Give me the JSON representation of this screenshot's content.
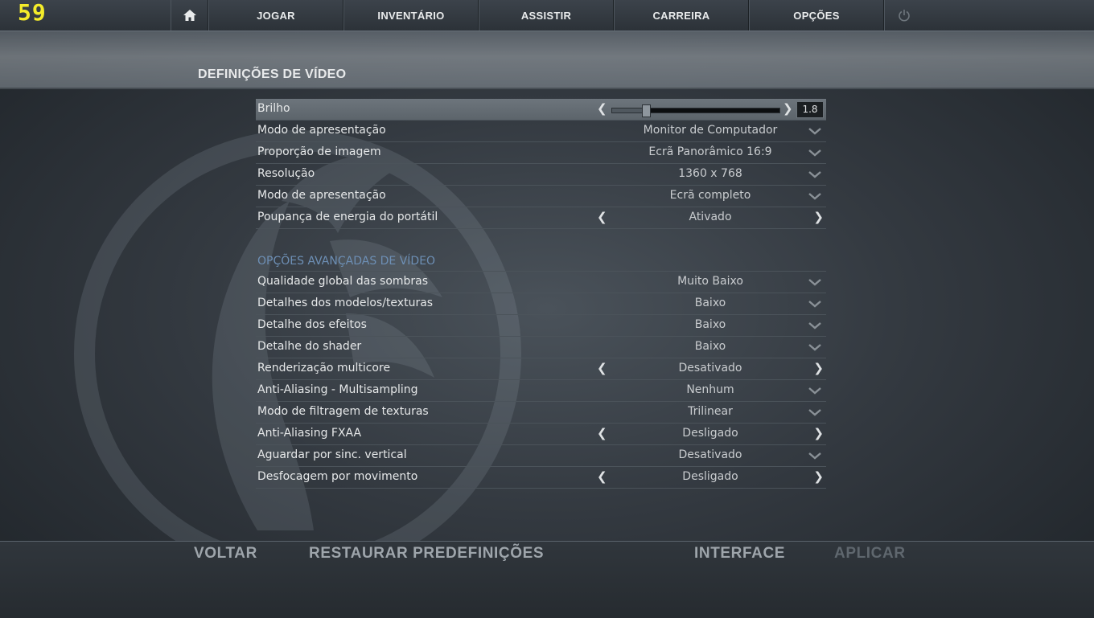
{
  "fps": "59",
  "nav": {
    "items": [
      "JOGAR",
      "INVENTÁRIO",
      "ASSISTIR",
      "CARREIRA",
      "OPÇÕES"
    ]
  },
  "page": {
    "title": "DEFINIÇÕES DE VÍDEO"
  },
  "brightness": {
    "label": "Brilho",
    "value": "1.8",
    "fraction": 0.2
  },
  "basic_settings": [
    {
      "label": "Modo de apresentação",
      "value": "Monitor de Computador",
      "control": "dropdown"
    },
    {
      "label": "Proporção de imagem",
      "value": "Ecrã Panorâmico 16:9",
      "control": "dropdown"
    },
    {
      "label": "Resolução",
      "value": "1360 x 768",
      "control": "dropdown"
    },
    {
      "label": "Modo de apresentação",
      "value": "Ecrã completo",
      "control": "dropdown"
    },
    {
      "label": "Poupança de energia do portátil",
      "value": "Ativado",
      "control": "toggle"
    }
  ],
  "advanced": {
    "title": "OPÇÕES AVANÇADAS DE VÍDEO",
    "settings": [
      {
        "label": "Qualidade global das sombras",
        "value": "Muito Baixo",
        "control": "dropdown"
      },
      {
        "label": "Detalhes dos modelos/texturas",
        "value": "Baixo",
        "control": "dropdown"
      },
      {
        "label": "Detalhe dos efeitos",
        "value": "Baixo",
        "control": "dropdown"
      },
      {
        "label": "Detalhe do shader",
        "value": "Baixo",
        "control": "dropdown"
      },
      {
        "label": "Renderização multicore",
        "value": "Desativado",
        "control": "toggle"
      },
      {
        "label": "Anti-Aliasing - Multisampling",
        "value": "Nenhum",
        "control": "dropdown"
      },
      {
        "label": "Modo de filtragem de texturas",
        "value": "Trilinear",
        "control": "dropdown"
      },
      {
        "label": "Anti-Aliasing FXAA",
        "value": "Desligado",
        "control": "toggle"
      },
      {
        "label": "Aguardar por sinc. vertical",
        "value": "Desativado",
        "control": "dropdown"
      },
      {
        "label": "Desfocagem por movimento",
        "value": "Desligado",
        "control": "toggle"
      }
    ]
  },
  "footer": {
    "back": "VOLTAR",
    "restore": "RESTAURAR PREDEFINIÇÕES",
    "interface": "INTERFACE",
    "apply": "APLICAR"
  },
  "icons": {
    "home": "home-icon",
    "power": "power-icon",
    "dropdown": "chevron-down-icon"
  },
  "colors": {
    "fps": "#f4ec2a",
    "section_title": "#6d8fb5",
    "disabled": "#5f676e"
  }
}
